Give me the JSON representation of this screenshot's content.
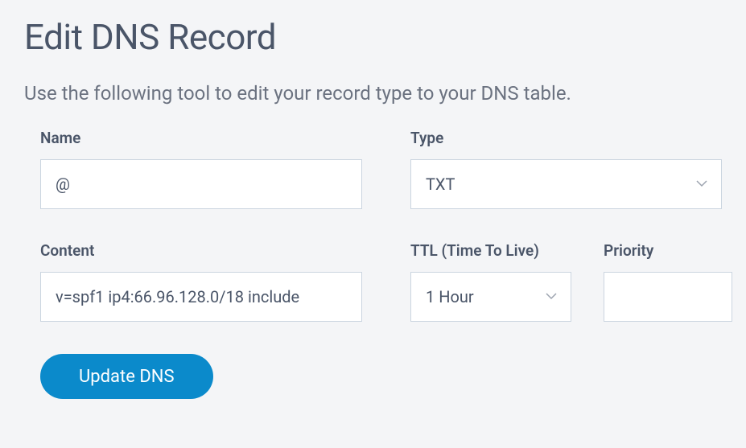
{
  "page": {
    "title": "Edit DNS Record",
    "description": "Use the following tool to edit your record type to your DNS table."
  },
  "fields": {
    "name": {
      "label": "Name",
      "value": "@"
    },
    "type": {
      "label": "Type",
      "value": "TXT"
    },
    "content": {
      "label": "Content",
      "value": "v=spf1 ip4:66.96.128.0/18 include"
    },
    "ttl": {
      "label": "TTL (Time To Live)",
      "value": "1 Hour"
    },
    "priority": {
      "label": "Priority",
      "value": ""
    }
  },
  "actions": {
    "submit_label": "Update DNS"
  }
}
